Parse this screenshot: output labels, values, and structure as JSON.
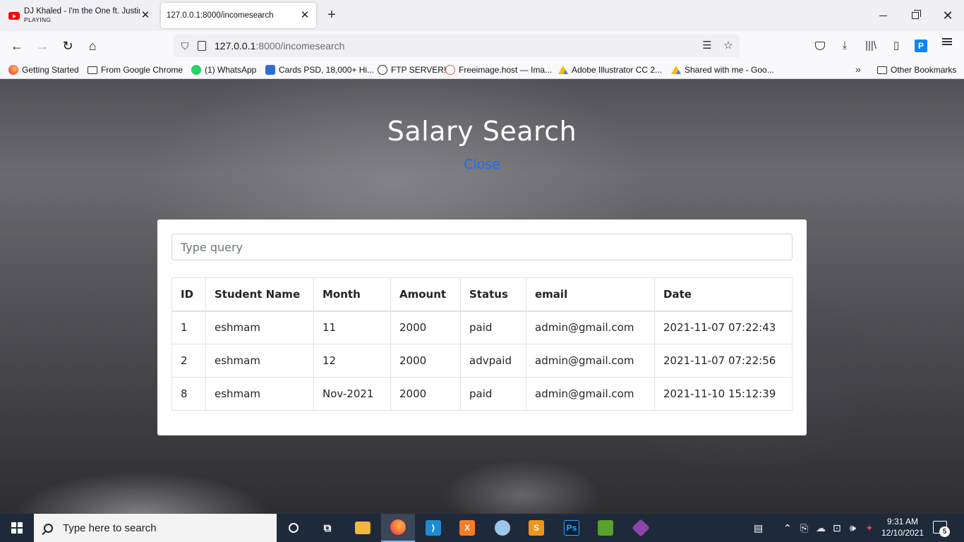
{
  "browser": {
    "tabs": [
      {
        "title": "DJ Khaled - I'm the One ft. Justin",
        "subtitle": "PLAYING"
      },
      {
        "title": "127.0.0.1:8000/incomesearch"
      }
    ],
    "url_host": "127.0.0.1",
    "url_rest": ":8000/incomesearch",
    "bookmarks": [
      {
        "label": "Getting Started",
        "icon": "firefox-icon"
      },
      {
        "label": "From Google Chrome",
        "icon": "folder-icon"
      },
      {
        "label": "(1) WhatsApp",
        "icon": "whatsapp-icon"
      },
      {
        "label": "Cards PSD, 18,000+ Hi...",
        "icon": "cards-icon"
      },
      {
        "label": "FTP SERVER!",
        "icon": "globe-icon"
      },
      {
        "label": "Freeimage.host — Ima...",
        "icon": "freeimage-icon"
      },
      {
        "label": "Adobe Illustrator CC 2...",
        "icon": "drive-icon"
      },
      {
        "label": "Shared with me - Goo...",
        "icon": "drive-icon"
      }
    ],
    "other_bookmarks": "Other Bookmarks"
  },
  "page": {
    "title": "Salary Search",
    "close_link": "Close",
    "search_placeholder": "Type query",
    "table": {
      "headers": [
        "ID",
        "Student Name",
        "Month",
        "Amount",
        "Status",
        "email",
        "Date"
      ],
      "rows": [
        [
          "1",
          "eshmam",
          "11",
          "2000",
          "paid",
          "admin@gmail.com",
          "2021-11-07 07:22:43"
        ],
        [
          "2",
          "eshmam",
          "12",
          "2000",
          "advpaid",
          "admin@gmail.com",
          "2021-11-07 07:22:56"
        ],
        [
          "8",
          "eshmam",
          "Nov-2021",
          "2000",
          "paid",
          "admin@gmail.com",
          "2021-11-10 15:12:39"
        ]
      ]
    }
  },
  "taskbar": {
    "search_placeholder": "Type here to search",
    "time": "9:31 AM",
    "date": "12/10/2021",
    "notification_count": "5"
  },
  "colors": {
    "link": "#1a6ef5",
    "taskbar": "#1e2a3a",
    "card": "#ffffff"
  }
}
